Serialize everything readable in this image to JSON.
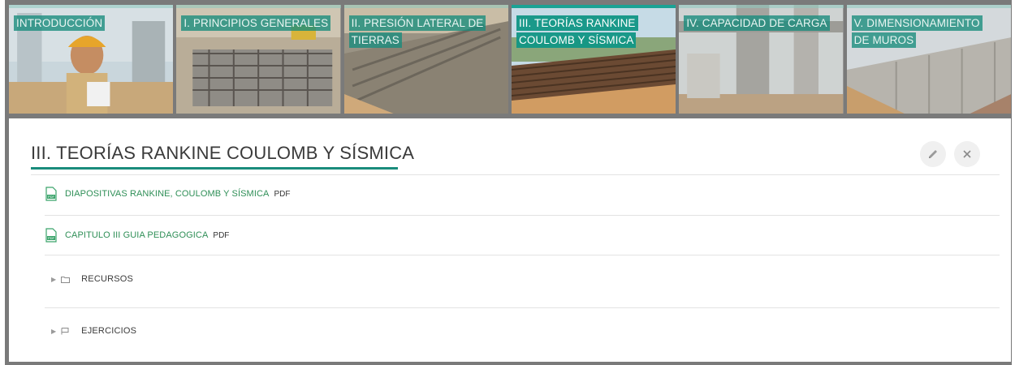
{
  "tabs": [
    {
      "label_lines": [
        "INTRODUCCIÓN"
      ],
      "active": false
    },
    {
      "label_lines": [
        "I. PRINCIPIOS GENERALES"
      ],
      "active": false
    },
    {
      "label_lines": [
        "II. PRESIÓN LATERAL DE",
        "TIERRAS"
      ],
      "active": false
    },
    {
      "label_lines": [
        "III. TEORÍAS RANKINE",
        "COULOMB Y SÍSMICA"
      ],
      "active": true
    },
    {
      "label_lines": [
        "IV. CAPACIDAD DE CARGA"
      ],
      "active": false
    },
    {
      "label_lines": [
        "V. DIMENSIONAMIENTO",
        "DE MUROS"
      ],
      "active": false
    }
  ],
  "section": {
    "title": "III. TEORÍAS RANKINE COULOMB Y SÍSMICA",
    "edit_icon": "pencil-icon",
    "close_icon": "close-icon"
  },
  "resources": [
    {
      "name": "DIAPOSITIVAS RANKINE, COULOMB Y SÍSMICA",
      "type": "PDF"
    },
    {
      "name": "CAPITULO III GUIA PEDAGOGICA",
      "type": "PDF"
    }
  ],
  "folders": [
    {
      "name": "RECURSOS"
    },
    {
      "name": "EJERCICIOS"
    }
  ],
  "colors": {
    "accent": "#1a8c7c",
    "link": "#2f8f57"
  }
}
